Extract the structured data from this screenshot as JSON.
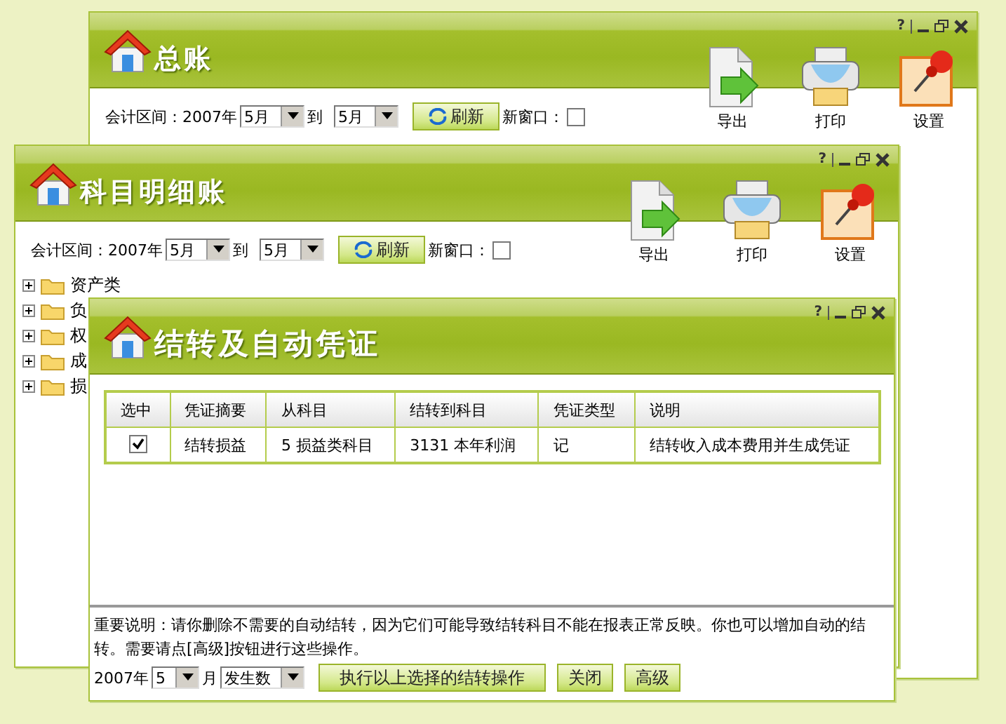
{
  "windows": [
    {
      "kind": "ledger",
      "title": "总账",
      "help": "?",
      "filter": {
        "label": "会计区间：2007年",
        "from": "5月",
        "to_label": "到",
        "to": "5月",
        "refresh": "刷新",
        "new_window_label": "新窗口：",
        "new_window": false
      },
      "toolbar": [
        {
          "kind": "export",
          "label": "导出"
        },
        {
          "kind": "print",
          "label": "打印"
        },
        {
          "kind": "settings",
          "label": "设置"
        }
      ]
    },
    {
      "kind": "ledger",
      "title": "科目明细账",
      "help": "?",
      "filter": {
        "label": "会计区间：2007年",
        "from": "5月",
        "to_label": "到",
        "to": "5月",
        "refresh": "刷新",
        "new_window_label": "新窗口：",
        "new_window": false
      },
      "toolbar": [
        {
          "kind": "export",
          "label": "导出"
        },
        {
          "kind": "print",
          "label": "打印"
        },
        {
          "kind": "settings",
          "label": "设置"
        }
      ],
      "tree": [
        {
          "label": "资产类",
          "expanded": false
        },
        {
          "label": "负",
          "expanded": false
        },
        {
          "label": "权",
          "expanded": false
        },
        {
          "label": "成",
          "expanded": false
        },
        {
          "label": "损",
          "expanded": false
        }
      ]
    },
    {
      "kind": "carryover",
      "title": "结转及自动凭证",
      "help": "?",
      "table": {
        "columns": [
          "选中",
          "凭证摘要",
          "从科目",
          "结转到科目",
          "凭证类型",
          "说明"
        ],
        "rows": [
          {
            "cells": [
              {
                "kind": "checkbox",
                "checked": true
              },
              {
                "kind": "text",
                "text": "结转损益"
              },
              {
                "kind": "text",
                "text": "5  损益类科目"
              },
              {
                "kind": "text",
                "text": "3131  本年利润"
              },
              {
                "kind": "text",
                "text": "记"
              },
              {
                "kind": "text",
                "text": "结转收入成本费用并生成凭证"
              }
            ]
          }
        ]
      },
      "note": "重要说明：请你删除不需要的自动结转，因为它们可能导致结转科目不能在报表正常反映。你也可以增加自动的结转。需要请点[高级]按钮进行这些操作。",
      "footer": {
        "year": "2007年",
        "month": "5",
        "month_label": "月",
        "type": "发生数",
        "buttons": [
          "执行以上选择的结转操作",
          "关闭",
          "高级"
        ]
      }
    }
  ]
}
